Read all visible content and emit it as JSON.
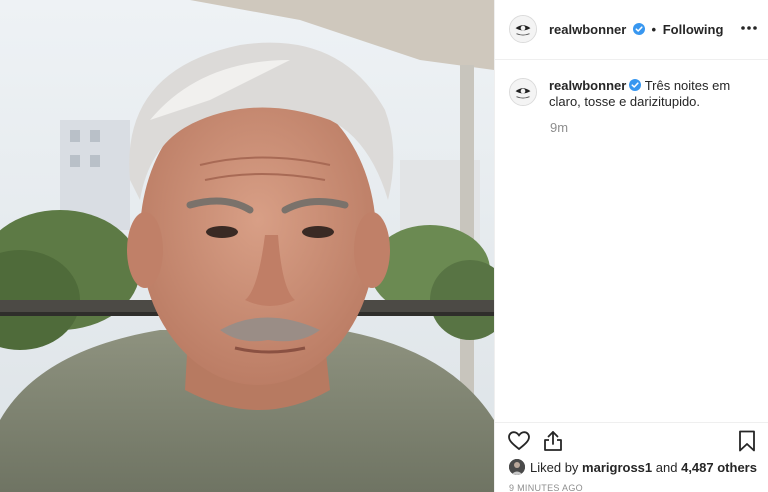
{
  "post": {
    "username": "realwbonner",
    "header_separator": "•",
    "follow_status": "Following",
    "caption": "Três noites em claro, tosse e darizitupido.",
    "relative_time": "9m",
    "likes": {
      "prefix": "Liked by",
      "liker": "marigross1",
      "joiner": "and",
      "others": "4,487 others"
    },
    "timestamp": "9 MINUTES AGO"
  },
  "icons": {
    "verified": "verified-badge-icon",
    "more": "more-options-icon",
    "like": "heart-icon",
    "share": "share-icon",
    "save": "bookmark-icon"
  },
  "colors": {
    "verified_blue": "#3897f0",
    "text": "#262626",
    "muted": "#8e8e8e"
  }
}
